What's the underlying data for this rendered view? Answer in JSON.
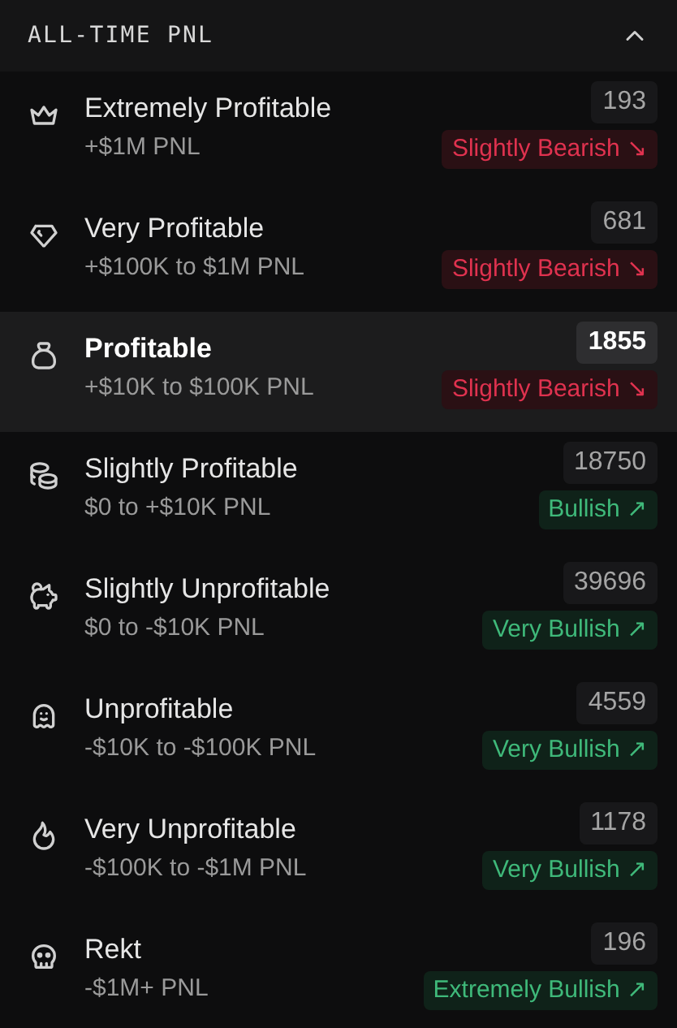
{
  "header": {
    "title": "ALL-TIME PNL",
    "expanded": true
  },
  "tiers": [
    {
      "name": "Extremely Profitable",
      "range": "+$1M PNL",
      "count": "193",
      "sentiment": {
        "label": "Slightly Bearish ↘",
        "kind": "bearish"
      },
      "selected": false
    },
    {
      "name": "Very Profitable",
      "range": "+$100K to $1M PNL",
      "count": "681",
      "sentiment": {
        "label": "Slightly Bearish ↘",
        "kind": "bearish"
      },
      "selected": false
    },
    {
      "name": "Profitable",
      "range": "+$10K to $100K PNL",
      "count": "1855",
      "sentiment": {
        "label": "Slightly Bearish ↘",
        "kind": "bearish"
      },
      "selected": true
    },
    {
      "name": "Slightly Profitable",
      "range": "$0 to +$10K PNL",
      "count": "18750",
      "sentiment": {
        "label": "Bullish ↗",
        "kind": "bullish"
      },
      "selected": false
    },
    {
      "name": "Slightly Unprofitable",
      "range": "$0 to -$10K PNL",
      "count": "39696",
      "sentiment": {
        "label": "Very Bullish ↗",
        "kind": "bullish"
      },
      "selected": false
    },
    {
      "name": "Unprofitable",
      "range": "-$10K to -$100K PNL",
      "count": "4559",
      "sentiment": {
        "label": "Very Bullish ↗",
        "kind": "bullish"
      },
      "selected": false
    },
    {
      "name": "Very Unprofitable",
      "range": "-$100K to -$1M PNL",
      "count": "1178",
      "sentiment": {
        "label": "Very Bullish ↗",
        "kind": "bullish"
      },
      "selected": false
    },
    {
      "name": "Rekt",
      "range": "-$1M+ PNL",
      "count": "196",
      "sentiment": {
        "label": "Extremely Bullish ↗",
        "kind": "bullish"
      },
      "selected": false
    }
  ]
}
